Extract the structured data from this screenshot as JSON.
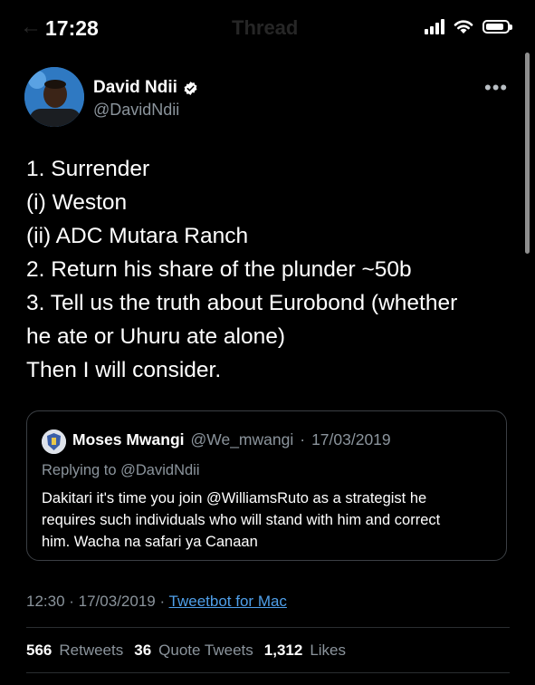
{
  "status_bar": {
    "time": "17:28",
    "icons": [
      "signal-icon",
      "wifi-icon",
      "battery-icon"
    ],
    "battery_level": 0.85
  },
  "nav": {
    "back_icon": "back-arrow-icon",
    "title": "Thread"
  },
  "author": {
    "name": "David Ndii",
    "handle": "@DavidNdii",
    "verified_icon": "verified-badge-icon",
    "more_label": "•••"
  },
  "tweet": {
    "lines": [
      "1. Surrender",
      "(i) Weston",
      "(ii) ADC Mutara Ranch",
      "2. Return his share of the plunder ~50b",
      "3. Tell us the truth about Eurobond (whether",
      "he ate or Uhuru ate alone)",
      "Then I will consider."
    ]
  },
  "quoted_tweet": {
    "name": "Moses Mwangi",
    "handle": "@We_mwangi",
    "separator": "·",
    "date": "17/03/2019",
    "replying_to": "Replying to @DavidNdii",
    "lines": [
      "Dakitari it's time you join @WilliamsRuto as a strategist he",
      "requires such individuals who will stand with him and correct",
      "him. Wacha na safari ya Canaan"
    ]
  },
  "meta": {
    "timestamp": "12:30 · 17/03/2019 · ",
    "source": "Tweetbot for Mac"
  },
  "stats": {
    "retweets_count": "566",
    "retweets_label": "Retweets",
    "quotes_count": "36",
    "quotes_label": "Quote Tweets",
    "likes_count": "1,312",
    "likes_label": "Likes"
  },
  "colors": {
    "background": "#000000",
    "text_primary": "#ffffff",
    "text_secondary": "#8b949c",
    "link": "#4f9fe9",
    "verified_badge": "#ffffff"
  }
}
